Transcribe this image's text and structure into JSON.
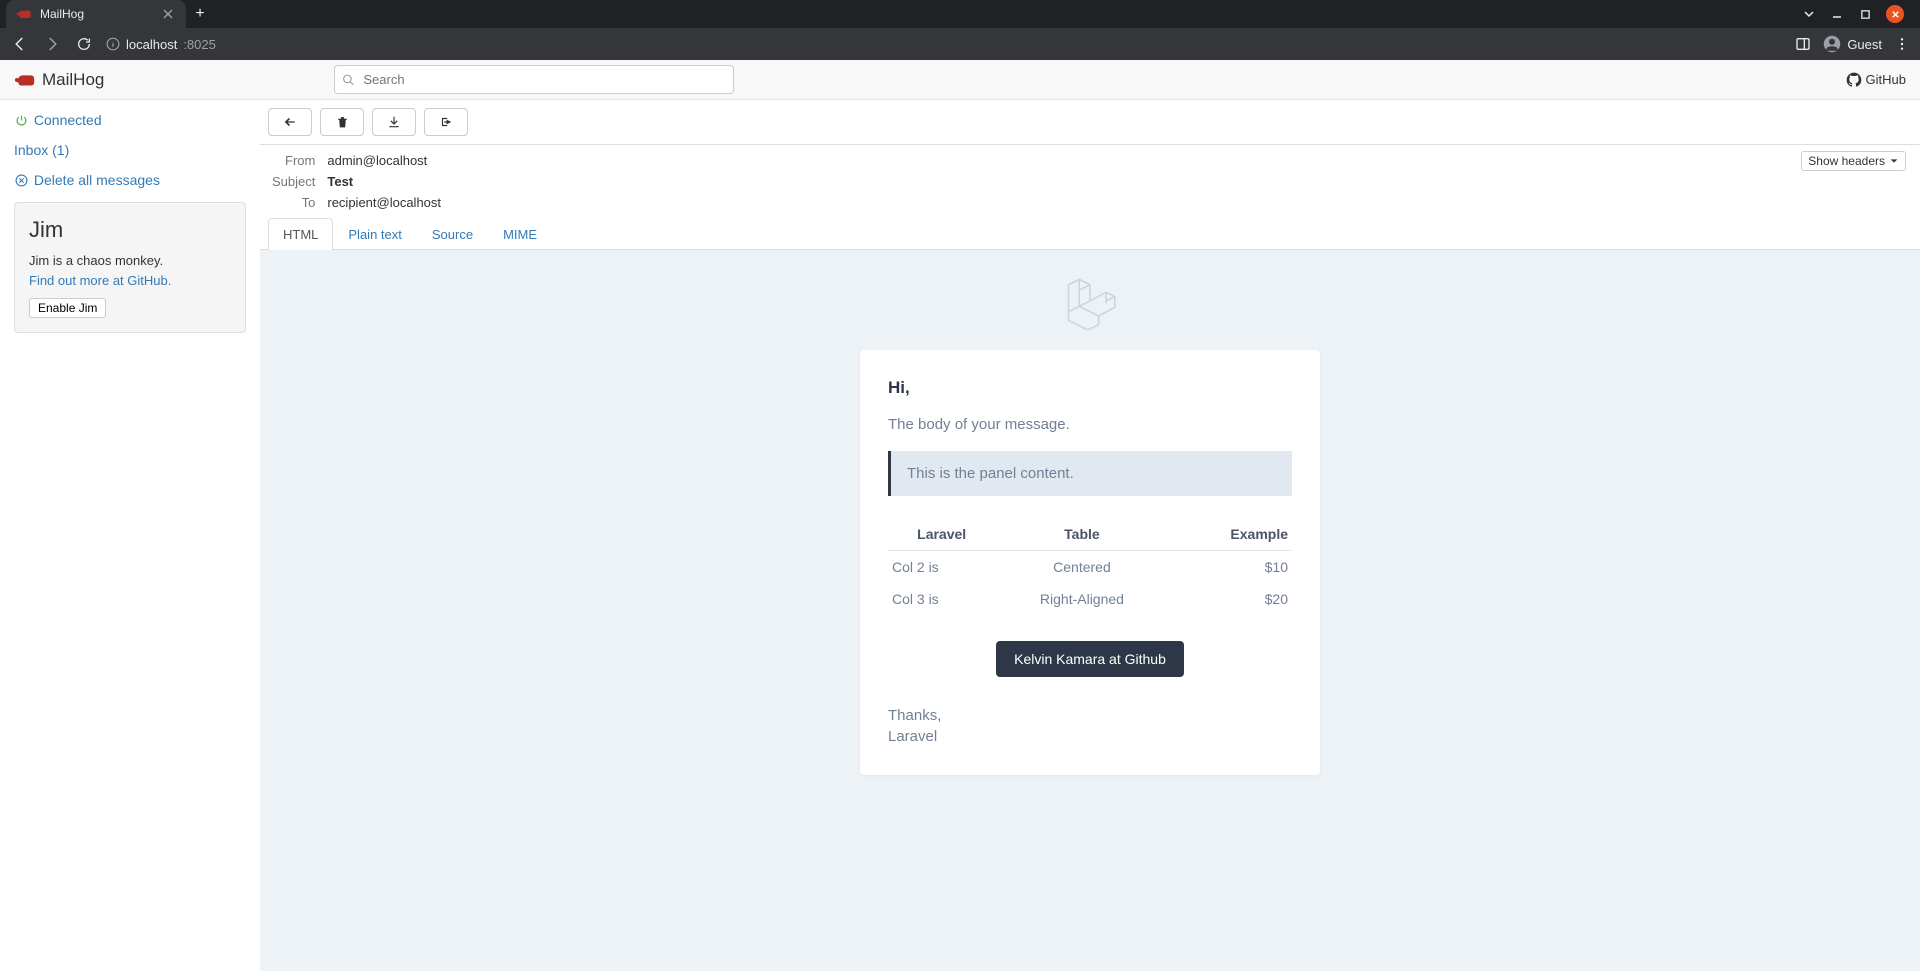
{
  "browser": {
    "tab_title": "MailHog",
    "url_host": "localhost",
    "url_port": ":8025",
    "guest_label": "Guest"
  },
  "header": {
    "brand": "MailHog",
    "search_placeholder": "Search",
    "github_label": "GitHub"
  },
  "sidebar": {
    "connected_label": "Connected",
    "inbox_label": "Inbox (1)",
    "delete_all_label": "Delete all messages",
    "jim": {
      "title": "Jim",
      "desc": "Jim is a chaos monkey.",
      "link": "Find out more at GitHub.",
      "button": "Enable Jim"
    }
  },
  "message": {
    "from_label": "From",
    "from_value": "admin@localhost",
    "subject_label": "Subject",
    "subject_value": "Test",
    "to_label": "To",
    "to_value": "recipient@localhost",
    "show_headers": "Show headers"
  },
  "tabs": {
    "html": "HTML",
    "plain": "Plain text",
    "source": "Source",
    "mime": "MIME"
  },
  "email": {
    "greeting": "Hi,",
    "body": "The body of your message.",
    "panel": "This is the panel content.",
    "table": {
      "headers": [
        "Laravel",
        "Table",
        "Example"
      ],
      "rows": [
        [
          "Col 2 is",
          "Centered",
          "$10"
        ],
        [
          "Col 3 is",
          "Right-Aligned",
          "$20"
        ]
      ]
    },
    "button": "Kelvin Kamara at Github",
    "signoff1": "Thanks,",
    "signoff2": "Laravel"
  }
}
